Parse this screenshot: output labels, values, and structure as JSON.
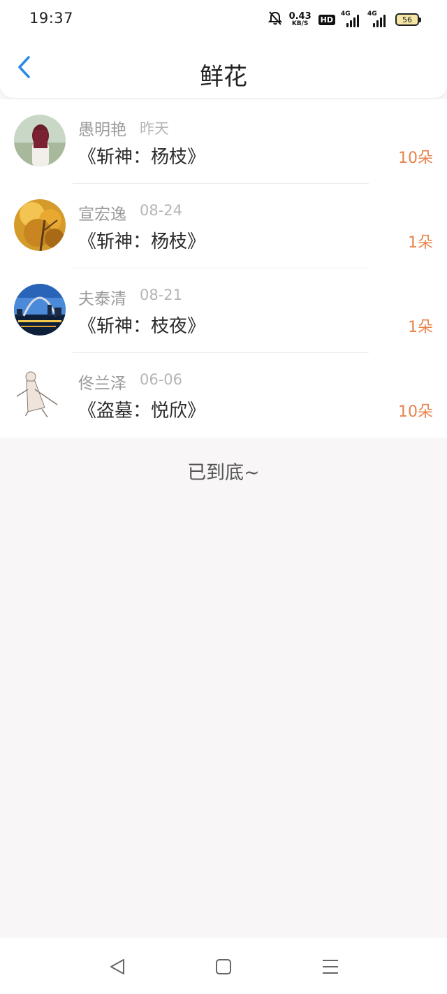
{
  "status_bar": {
    "time": "19:37",
    "net_speed_value": "0.43",
    "net_speed_unit": "KB/S",
    "hd_label": "HD",
    "signal1_tag": "4G",
    "signal2_tag": "4G",
    "battery_level": "56",
    "icons": [
      "bell-off-icon",
      "signal-icon",
      "signal-icon",
      "battery-icon"
    ]
  },
  "header": {
    "title": "鲜花",
    "back_icon": "chevron-left-icon",
    "accent_color": "#2a8be6"
  },
  "list": {
    "items": [
      {
        "name": "愚明艳",
        "date": "昨天",
        "work": "《斩神：杨枝》",
        "count": "10朵"
      },
      {
        "name": "宣宏逸",
        "date": "08-24",
        "work": "《斩神：杨枝》",
        "count": "1朵"
      },
      {
        "name": "夫泰清",
        "date": "08-21",
        "work": "《斩神：枝夜》",
        "count": "1朵"
      },
      {
        "name": "佟兰泽",
        "date": "06-06",
        "work": "《盗墓：悦欣》",
        "count": "10朵"
      }
    ],
    "count_color": "#e8834a"
  },
  "footer": {
    "end_text": "已到底~"
  },
  "nav_bar": {
    "icons": [
      "back-triangle-icon",
      "home-square-icon",
      "menu-lines-icon"
    ]
  }
}
